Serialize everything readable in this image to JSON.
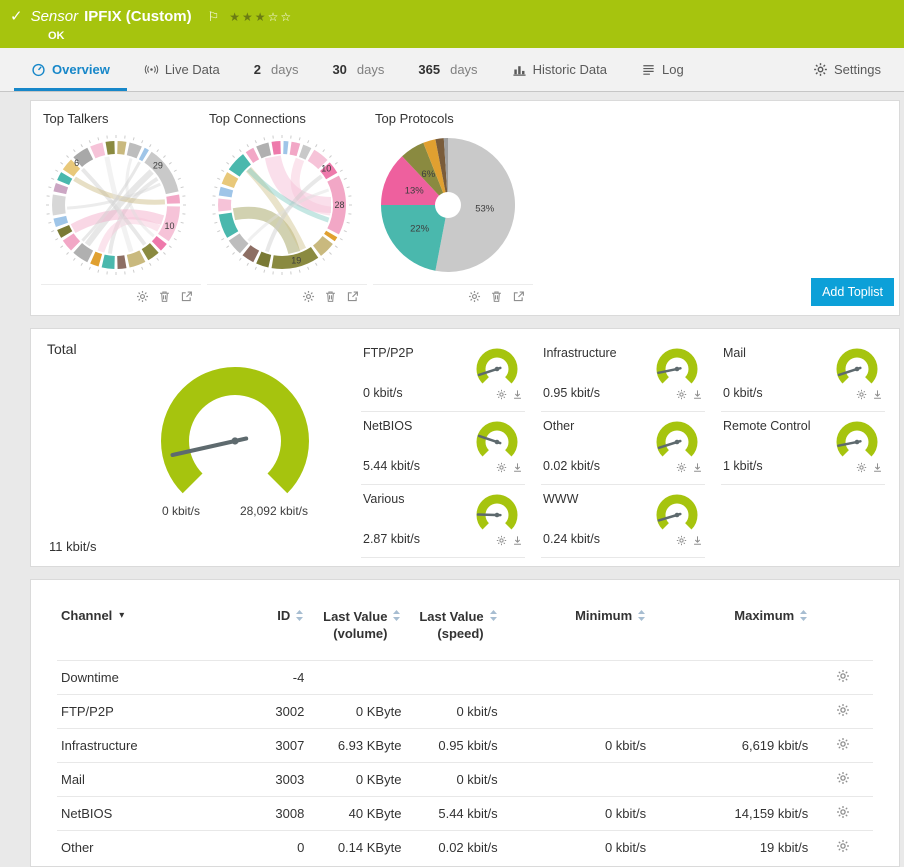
{
  "header": {
    "kind": "Sensor",
    "title": "IPFIX (Custom)",
    "status": "OK",
    "stars": {
      "filled": 3,
      "total": 5
    }
  },
  "icons": {
    "status_ok": "✓",
    "flag": "⚐",
    "star_filled": "★",
    "star_empty": "☆",
    "sort_caret": "▾"
  },
  "tabs": {
    "overview": "Overview",
    "live_data": "Live Data",
    "days2": {
      "num": "2",
      "unit": "days"
    },
    "days30": {
      "num": "30",
      "unit": "days"
    },
    "days365": {
      "num": "365",
      "unit": "days"
    },
    "historic": "Historic Data",
    "log": "Log",
    "settings": "Settings"
  },
  "toplists": {
    "add_button": "Add Toplist",
    "talkers": {
      "title": "Top Talkers",
      "labels": [
        {
          "text": "29",
          "pos": 0.13
        },
        {
          "text": "10",
          "pos": 0.31
        },
        {
          "text": "6",
          "pos": 0.88
        }
      ],
      "segments": [
        {
          "c": "#c9b97e",
          "f": 0.03
        },
        {
          "c": "#bdbdbd",
          "f": 0.04
        },
        {
          "c": "#9fc5e8",
          "f": 0.02
        },
        {
          "c": "#c9c9c9",
          "f": 0.13
        },
        {
          "c": "#f2a7c6",
          "f": 0.03
        },
        {
          "c": "#f6c3d8",
          "f": 0.1
        },
        {
          "c": "#ee79ab",
          "f": 0.03
        },
        {
          "c": "#8a8a40",
          "f": 0.04
        },
        {
          "c": "#c9b97e",
          "f": 0.05
        },
        {
          "c": "#8d6e63",
          "f": 0.03
        },
        {
          "c": "#4ab8ad",
          "f": 0.04
        },
        {
          "c": "#e0a030",
          "f": 0.03
        },
        {
          "c": "#b0b0b0",
          "f": 0.05
        },
        {
          "c": "#f2a7c6",
          "f": 0.04
        },
        {
          "c": "#7a7a35",
          "f": 0.03
        },
        {
          "c": "#9fc5e8",
          "f": 0.03
        },
        {
          "c": "#d7d7d7",
          "f": 0.06
        },
        {
          "c": "#cba6c3",
          "f": 0.03
        },
        {
          "c": "#4ab8ad",
          "f": 0.03
        },
        {
          "c": "#e8c87a",
          "f": 0.04
        },
        {
          "c": "#a8a8a8",
          "f": 0.05
        },
        {
          "c": "#f6c3d8",
          "f": 0.04
        },
        {
          "c": "#8a8a40",
          "f": 0.03
        }
      ],
      "ribbons": [
        {
          "a": 0.13,
          "b": 0.6,
          "c": "#c9c9c9",
          "w": 6
        },
        {
          "a": 0.16,
          "b": 0.52,
          "c": "#cfcfcf",
          "w": 4
        },
        {
          "a": 0.3,
          "b": 0.67,
          "c": "#f2a7c6",
          "w": 10
        },
        {
          "a": 0.33,
          "b": 0.55,
          "c": "#f6c3d8",
          "w": 7
        },
        {
          "a": 0.05,
          "b": 0.36,
          "c": "#dddddd",
          "w": 3
        },
        {
          "a": 0.88,
          "b": 0.4,
          "c": "#cccccc",
          "w": 4
        },
        {
          "a": 0.84,
          "b": 0.24,
          "c": "#c9b97e",
          "w": 5
        },
        {
          "a": 0.74,
          "b": 0.18,
          "c": "#d5d5d5",
          "w": 3
        },
        {
          "a": 0.97,
          "b": 0.45,
          "c": "#e3e3e3",
          "w": 5
        },
        {
          "a": 0.62,
          "b": 0.08,
          "c": "#cccccc",
          "w": 3
        }
      ]
    },
    "connections": {
      "title": "Top Connections",
      "labels": [
        {
          "text": "10",
          "pos": 0.14
        },
        {
          "text": "28",
          "pos": 0.25
        },
        {
          "text": "19",
          "pos": 0.46
        }
      ],
      "segments": [
        {
          "c": "#9fc5e8",
          "f": 0.02
        },
        {
          "c": "#f2a7c6",
          "f": 0.03
        },
        {
          "c": "#c9c9c9",
          "f": 0.03
        },
        {
          "c": "#f6c3d8",
          "f": 0.05
        },
        {
          "c": "#ee79ab",
          "f": 0.04
        },
        {
          "c": "#f2a7c6",
          "f": 0.16
        },
        {
          "c": "#e0a030",
          "f": 0.02
        },
        {
          "c": "#c9b97e",
          "f": 0.05
        },
        {
          "c": "#8a8a40",
          "f": 0.13
        },
        {
          "c": "#7a7a35",
          "f": 0.04
        },
        {
          "c": "#8d6e63",
          "f": 0.04
        },
        {
          "c": "#bdbdbd",
          "f": 0.05
        },
        {
          "c": "#4ab8ad",
          "f": 0.07
        },
        {
          "c": "#f6c3d8",
          "f": 0.04
        },
        {
          "c": "#9fc5e8",
          "f": 0.03
        },
        {
          "c": "#e8c87a",
          "f": 0.04
        },
        {
          "c": "#4ab8ad",
          "f": 0.06
        },
        {
          "c": "#f2a7c6",
          "f": 0.03
        },
        {
          "c": "#b0b0b0",
          "f": 0.04
        },
        {
          "c": "#ee79ab",
          "f": 0.03
        }
      ],
      "ribbons": [
        {
          "a": 0.25,
          "b": 0.97,
          "c": "#f4b8d2",
          "w": 16
        },
        {
          "a": 0.27,
          "b": 0.06,
          "c": "#f6c3d8",
          "w": 9
        },
        {
          "a": 0.46,
          "b": 0.72,
          "c": "#9a9a50",
          "w": 12
        },
        {
          "a": 0.43,
          "b": 0.88,
          "c": "#cfc08a",
          "w": 7
        },
        {
          "a": 0.55,
          "b": 0.15,
          "c": "#cccccc",
          "w": 4
        },
        {
          "a": 0.88,
          "b": 0.3,
          "c": "#7fcac2",
          "w": 5
        },
        {
          "a": 0.62,
          "b": 0.2,
          "c": "#dddddd",
          "w": 3
        }
      ]
    },
    "protocols": {
      "title": "Top Protocols",
      "slices": [
        {
          "label": "53%",
          "value": 53,
          "color": "#c9c9c9"
        },
        {
          "label": "22%",
          "value": 22,
          "color": "#4ab8ad"
        },
        {
          "label": "13%",
          "value": 13,
          "color": "#ee609e"
        },
        {
          "label": "6%",
          "value": 6,
          "color": "#8a8a40"
        },
        {
          "label": "",
          "value": 3,
          "color": "#e0a030"
        },
        {
          "label": "",
          "value": 2,
          "color": "#7a5c3a"
        },
        {
          "label": "",
          "value": 1,
          "color": "#9e9e9e"
        }
      ]
    }
  },
  "gauges": {
    "total": {
      "title": "Total",
      "value": "11 kbit/s",
      "min": "0 kbit/s",
      "max": "28,092 kbit/s"
    },
    "items": [
      {
        "name": "FTP/P2P",
        "value": "0 kbit/s"
      },
      {
        "name": "Infrastructure",
        "value": "0.95 kbit/s"
      },
      {
        "name": "Mail",
        "value": "0 kbit/s"
      },
      {
        "name": "NetBIOS",
        "value": "5.44 kbit/s"
      },
      {
        "name": "Other",
        "value": "0.02 kbit/s"
      },
      {
        "name": "Remote Control",
        "value": "1 kbit/s"
      },
      {
        "name": "Various",
        "value": "2.87 kbit/s"
      },
      {
        "name": "WWW",
        "value": "0.24 kbit/s"
      }
    ]
  },
  "table": {
    "headers": {
      "channel": "Channel",
      "id": "ID",
      "last_volume": {
        "line1": "Last Value",
        "line2": "(volume)"
      },
      "last_speed": {
        "line1": "Last Value",
        "line2": "(speed)"
      },
      "minimum": "Minimum",
      "maximum": "Maximum"
    },
    "rows": [
      {
        "channel": "Downtime",
        "id": "-4",
        "volume": "",
        "speed": "",
        "min": "",
        "max": ""
      },
      {
        "channel": "FTP/P2P",
        "id": "3002",
        "volume": "0 KByte",
        "speed": "0 kbit/s",
        "min": "",
        "max": ""
      },
      {
        "channel": "Infrastructure",
        "id": "3007",
        "volume": "6.93 KByte",
        "speed": "0.95 kbit/s",
        "min": "0 kbit/s",
        "max": "6,619 kbit/s"
      },
      {
        "channel": "Mail",
        "id": "3003",
        "volume": "0 KByte",
        "speed": "0 kbit/s",
        "min": "",
        "max": ""
      },
      {
        "channel": "NetBIOS",
        "id": "3008",
        "volume": "40 KByte",
        "speed": "5.44 kbit/s",
        "min": "0 kbit/s",
        "max": "14,159 kbit/s"
      },
      {
        "channel": "Other",
        "id": "0",
        "volume": "0.14 KByte",
        "speed": "0.02 kbit/s",
        "min": "0 kbit/s",
        "max": "19 kbit/s"
      }
    ]
  },
  "colors": {
    "lime": "#a6c40e",
    "button_blue": "#0ca0d8",
    "tab_active_blue": "#1787c9",
    "needle": "#5e6a6e"
  }
}
